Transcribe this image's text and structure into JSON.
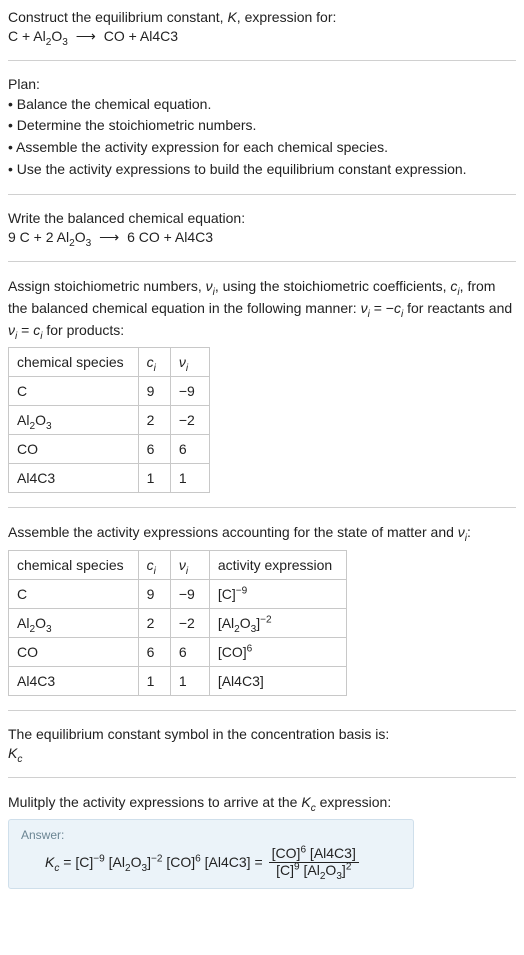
{
  "intro": {
    "line1_a": "Construct the equilibrium constant, ",
    "line1_b": "K",
    "line1_c": ", expression for:",
    "eq_unbalanced_lhs1": "C + Al",
    "eq_unbalanced_lhs_sub1": "2",
    "eq_unbalanced_lhs2": "O",
    "eq_unbalanced_lhs_sub2": "3",
    "arrow": "⟶",
    "eq_unbalanced_rhs": "CO + Al4C3"
  },
  "plan": {
    "heading": "Plan:",
    "b1": "• Balance the chemical equation.",
    "b2": "• Determine the stoichiometric numbers.",
    "b3": "• Assemble the activity expression for each chemical species.",
    "b4": "• Use the activity expressions to build the equilibrium constant expression."
  },
  "balanced": {
    "heading": "Write the balanced chemical equation:",
    "lhs1": "9 C + 2 Al",
    "lhs_sub1": "2",
    "lhs2": "O",
    "lhs_sub2": "3",
    "arrow": "⟶",
    "rhs": "6 CO + Al4C3"
  },
  "assign": {
    "t1": "Assign stoichiometric numbers, ",
    "t2": "ν",
    "t3": "i",
    "t4": ", using the stoichiometric coefficients, ",
    "t5": "c",
    "t6": "i",
    "t7": ", from the balanced chemical equation in the following manner: ",
    "t8": "ν",
    "t9": "i",
    "t10": " = −",
    "t11": "c",
    "t12": "i",
    "t13": " for reactants and ",
    "t14": "ν",
    "t15": "i",
    "t16": " = ",
    "t17": "c",
    "t18": "i",
    "t19": " for products:"
  },
  "table1": {
    "head1": "chemical species",
    "head2": "c",
    "head2_i": "i",
    "head3": "ν",
    "head3_i": "i",
    "r1": {
      "sp_a": "C",
      "sp_b": "",
      "sp_c": "",
      "c": "9",
      "v": "−9"
    },
    "r2": {
      "sp_a": "Al",
      "sp_sub1": "2",
      "sp_b": "O",
      "sp_sub2": "3",
      "c": "2",
      "v": "−2"
    },
    "r3": {
      "sp_a": "CO",
      "c": "6",
      "v": "6"
    },
    "r4": {
      "sp_a": "Al4C3",
      "c": "1",
      "v": "1"
    }
  },
  "assemble": {
    "t1": "Assemble the activity expressions accounting for the state of matter and ",
    "t2": "ν",
    "t3": "i",
    "t4": ":"
  },
  "table2": {
    "head1": "chemical species",
    "head2": "c",
    "head2_i": "i",
    "head3": "ν",
    "head3_i": "i",
    "head4": "activity expression",
    "r1": {
      "sp": "C",
      "c": "9",
      "v": "−9",
      "ae_a": "[C]",
      "ae_e": "−9"
    },
    "r2": {
      "sp_a": "Al",
      "sp_sub1": "2",
      "sp_b": "O",
      "sp_sub2": "3",
      "c": "2",
      "v": "−2",
      "ae_a": "[Al",
      "ae_sub1": "2",
      "ae_b": "O",
      "ae_sub2": "3",
      "ae_c": "]",
      "ae_e": "−2"
    },
    "r3": {
      "sp": "CO",
      "c": "6",
      "v": "6",
      "ae_a": "[CO]",
      "ae_e": "6"
    },
    "r4": {
      "sp": "Al4C3",
      "c": "1",
      "v": "1",
      "ae_a": "[Al4C3]"
    }
  },
  "symbol": {
    "line1": "The equilibrium constant symbol in the concentration basis is:",
    "sym": "K",
    "sym_sub": "c"
  },
  "multiply": {
    "t1": "Mulitply the activity expressions to arrive at the ",
    "t2": "K",
    "t3": "c",
    "t4": " expression:"
  },
  "answer": {
    "label": "Answer:",
    "lhs_K": "K",
    "lhs_c": "c",
    "eq": " = ",
    "te1": "[C]",
    "e1": "−9",
    "te2a": " [Al",
    "te2_sub1": "2",
    "te2b": "O",
    "te2_sub2": "3",
    "te2c": "]",
    "e2": "−2",
    "te3a": " [CO]",
    "e3": "6",
    "te4": " [Al4C3]",
    "eq2": " = ",
    "num_a": "[CO]",
    "num_e": "6",
    "num_b": " [Al4C3]",
    "den_a": "[C]",
    "den_e1": "9",
    "den_b": " [Al",
    "den_sub1": "2",
    "den_c": "O",
    "den_sub2": "3",
    "den_d": "]",
    "den_e2": "2"
  },
  "chart_data": {
    "type": "table",
    "table1": {
      "columns": [
        "chemical species",
        "c_i",
        "ν_i"
      ],
      "rows": [
        [
          "C",
          9,
          -9
        ],
        [
          "Al2O3",
          2,
          -2
        ],
        [
          "CO",
          6,
          6
        ],
        [
          "Al4C3",
          1,
          1
        ]
      ]
    },
    "table2": {
      "columns": [
        "chemical species",
        "c_i",
        "ν_i",
        "activity expression"
      ],
      "rows": [
        [
          "C",
          9,
          -9,
          "[C]^-9"
        ],
        [
          "Al2O3",
          2,
          -2,
          "[Al2O3]^-2"
        ],
        [
          "CO",
          6,
          6,
          "[CO]^6"
        ],
        [
          "Al4C3",
          1,
          1,
          "[Al4C3]"
        ]
      ]
    }
  }
}
